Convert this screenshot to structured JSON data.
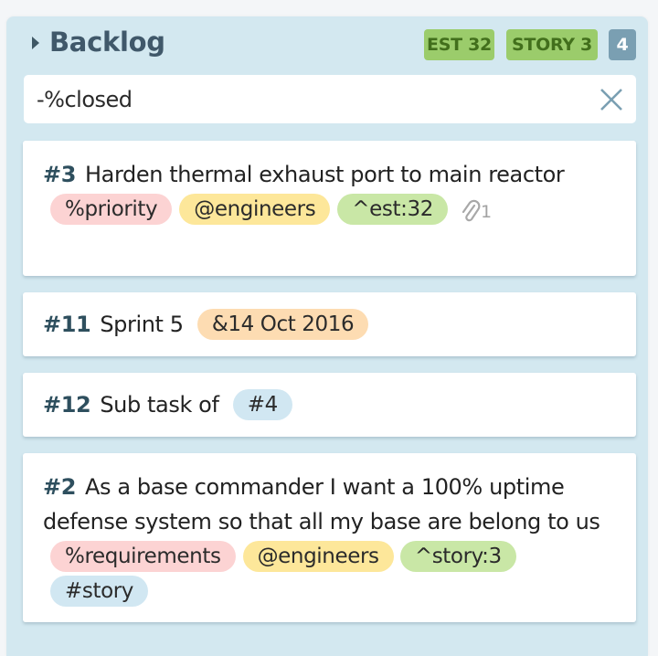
{
  "list": {
    "title": "Backlog",
    "badges": {
      "estimate": "EST 32",
      "story": "STORY 3",
      "count": "4"
    },
    "colors": {
      "panel_bg": "#d3e8f0",
      "badge_green": "#9bcc6b",
      "badge_count": "#7a9fb2",
      "issue_number": "#2e4f5e"
    }
  },
  "search": {
    "value": "-%closed",
    "clear_icon": "close-icon"
  },
  "cards": [
    {
      "number": "#3",
      "title": "Harden thermal exhaust port to main reactor",
      "tags": [
        {
          "text": "%priority",
          "color": "red"
        },
        {
          "text": "@engineers",
          "color": "yellow"
        },
        {
          "text": "^est:32",
          "color": "green"
        }
      ],
      "attachments": "1",
      "attachment_icon": "paperclip-icon"
    },
    {
      "number": "#11",
      "title": "Sprint 5",
      "tags": [
        {
          "text": "&14 Oct 2016",
          "color": "orange"
        }
      ]
    },
    {
      "number": "#12",
      "title": "Sub task of",
      "tags": [
        {
          "text": "#4",
          "color": "blue"
        }
      ]
    },
    {
      "number": "#2",
      "title": "As a base commander I want a 100% uptime defense system so that all my base are belong to us",
      "tags": [
        {
          "text": "%requirements",
          "color": "red"
        },
        {
          "text": "@engineers",
          "color": "yellow"
        },
        {
          "text": "^story:3",
          "color": "green"
        },
        {
          "text": "#story",
          "color": "blue"
        }
      ]
    }
  ]
}
